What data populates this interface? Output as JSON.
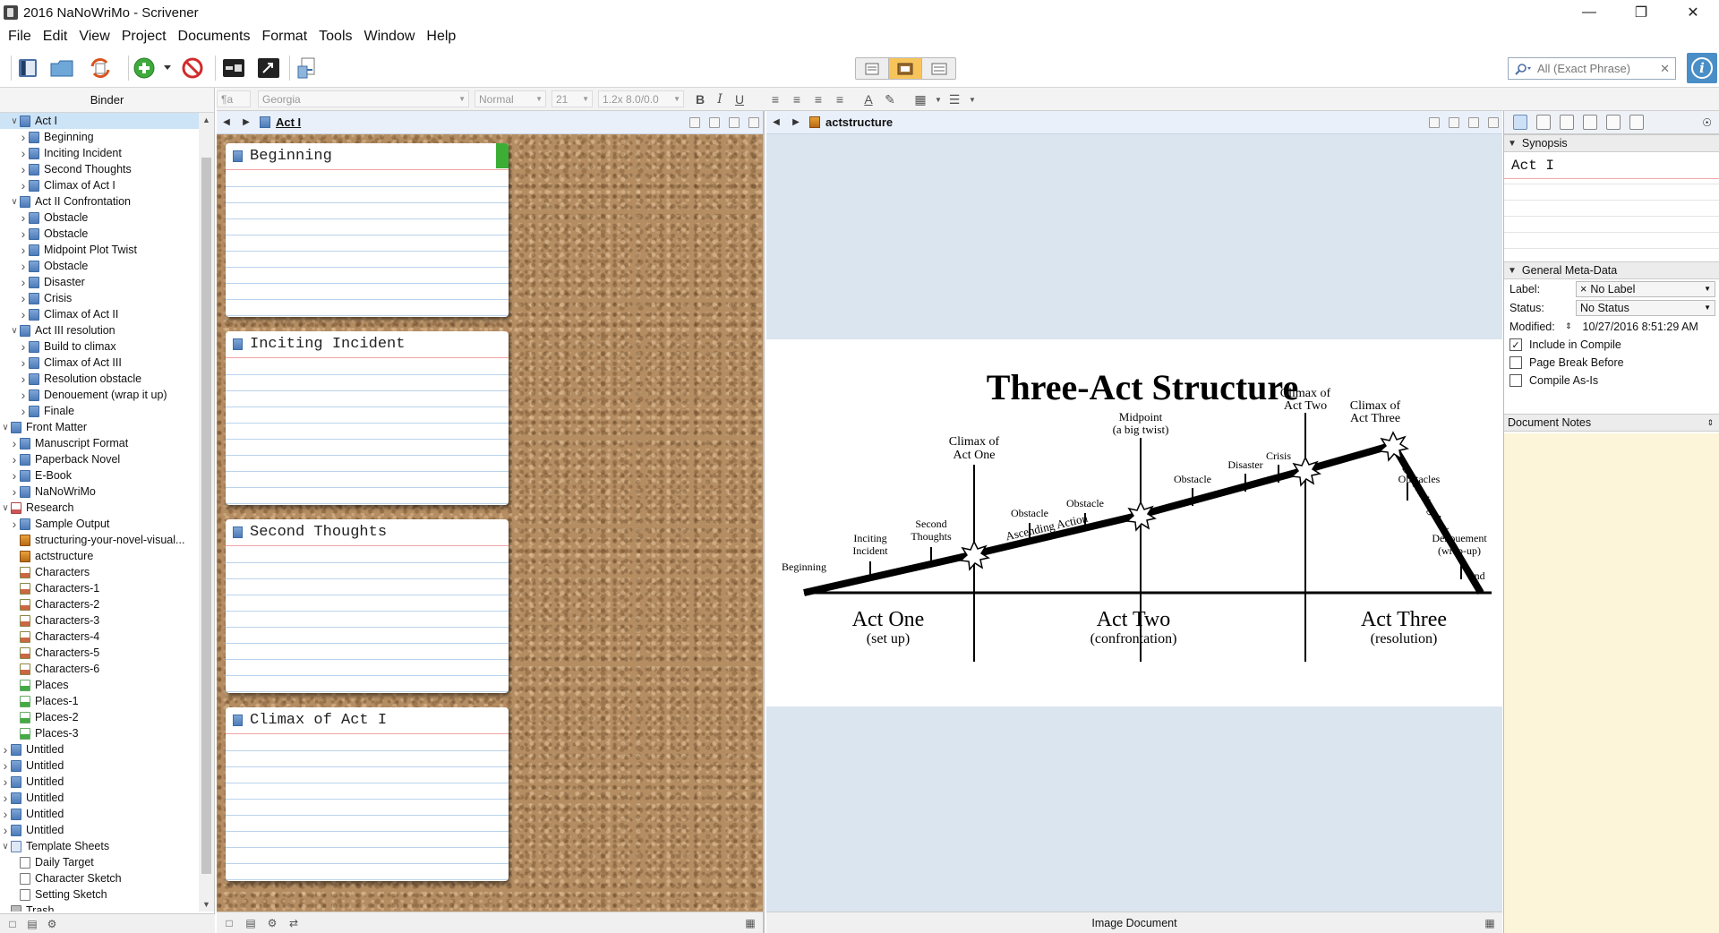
{
  "window": {
    "title": "2016 NaNoWriMo - Scrivener"
  },
  "menu": [
    "File",
    "Edit",
    "View",
    "Project",
    "Documents",
    "Format",
    "Tools",
    "Window",
    "Help"
  ],
  "toolbar": {
    "icons": [
      "binder-toggle-icon",
      "collections-icon",
      "sync-icon",
      "add-icon",
      "delete-icon",
      "quick-reference-icon",
      "fullscreen-icon",
      "compile-icon"
    ],
    "search_placeholder": "All (Exact Phrase)",
    "accent_color": "#f7c45b"
  },
  "binder": {
    "header": "Binder",
    "items": [
      {
        "label": "Act I",
        "depth": 0,
        "chev": "v",
        "icon": "folder",
        "selected": true
      },
      {
        "label": "Beginning",
        "depth": 1,
        "chev": ">",
        "icon": "folder"
      },
      {
        "label": "Inciting Incident",
        "depth": 1,
        "chev": ">",
        "icon": "folder"
      },
      {
        "label": "Second Thoughts",
        "depth": 1,
        "chev": ">",
        "icon": "folder"
      },
      {
        "label": "Climax of Act I",
        "depth": 1,
        "chev": ">",
        "icon": "folder"
      },
      {
        "label": "Act II Confrontation",
        "depth": 0,
        "chev": "v",
        "icon": "folder"
      },
      {
        "label": "Obstacle",
        "depth": 1,
        "chev": ">",
        "icon": "folder"
      },
      {
        "label": "Obstacle",
        "depth": 1,
        "chev": ">",
        "icon": "folder"
      },
      {
        "label": "Midpoint Plot Twist",
        "depth": 1,
        "chev": ">",
        "icon": "folder"
      },
      {
        "label": "Obstacle",
        "depth": 1,
        "chev": ">",
        "icon": "folder"
      },
      {
        "label": "Disaster",
        "depth": 1,
        "chev": ">",
        "icon": "folder"
      },
      {
        "label": "Crisis",
        "depth": 1,
        "chev": ">",
        "icon": "folder"
      },
      {
        "label": "Climax of Act II",
        "depth": 1,
        "chev": ">",
        "icon": "folder"
      },
      {
        "label": "Act III resolution",
        "depth": 0,
        "chev": "v",
        "icon": "folder"
      },
      {
        "label": "Build to climax",
        "depth": 1,
        "chev": ">",
        "icon": "folder"
      },
      {
        "label": "Climax of Act III",
        "depth": 1,
        "chev": ">",
        "icon": "folder"
      },
      {
        "label": "Resolution obstacle",
        "depth": 1,
        "chev": ">",
        "icon": "folder"
      },
      {
        "label": "Denouement (wrap it up)",
        "depth": 1,
        "chev": ">",
        "icon": "folder"
      },
      {
        "label": "Finale",
        "depth": 1,
        "chev": ">",
        "icon": "folder"
      },
      {
        "label": "Front Matter",
        "depth": -1,
        "chev": "v",
        "icon": "folder"
      },
      {
        "label": "Manuscript Format",
        "depth": 0,
        "chev": ">",
        "icon": "folder"
      },
      {
        "label": "Paperback Novel",
        "depth": 0,
        "chev": ">",
        "icon": "folder"
      },
      {
        "label": "E-Book",
        "depth": 0,
        "chev": ">",
        "icon": "folder"
      },
      {
        "label": "NaNoWriMo",
        "depth": 0,
        "chev": ">",
        "icon": "folder"
      },
      {
        "label": "Research",
        "depth": -1,
        "chev": "v",
        "icon": "research"
      },
      {
        "label": "Sample Output",
        "depth": 0,
        "chev": ">",
        "icon": "folder"
      },
      {
        "label": "structuring-your-novel-visual...",
        "depth": 0,
        "chev": "",
        "icon": "img"
      },
      {
        "label": "actstructure",
        "depth": 0,
        "chev": "",
        "icon": "img"
      },
      {
        "label": "Characters",
        "depth": 0,
        "chev": "",
        "icon": "pic"
      },
      {
        "label": "Characters-1",
        "depth": 0,
        "chev": "",
        "icon": "pic"
      },
      {
        "label": "Characters-2",
        "depth": 0,
        "chev": "",
        "icon": "pic"
      },
      {
        "label": "Characters-3",
        "depth": 0,
        "chev": "",
        "icon": "pic"
      },
      {
        "label": "Characters-4",
        "depth": 0,
        "chev": "",
        "icon": "pic"
      },
      {
        "label": "Characters-5",
        "depth": 0,
        "chev": "",
        "icon": "pic"
      },
      {
        "label": "Characters-6",
        "depth": 0,
        "chev": "",
        "icon": "pic"
      },
      {
        "label": "Places",
        "depth": 0,
        "chev": "",
        "icon": "place"
      },
      {
        "label": "Places-1",
        "depth": 0,
        "chev": "",
        "icon": "place"
      },
      {
        "label": "Places-2",
        "depth": 0,
        "chev": "",
        "icon": "place"
      },
      {
        "label": "Places-3",
        "depth": 0,
        "chev": "",
        "icon": "place"
      },
      {
        "label": "Untitled",
        "depth": -1,
        "chev": ">",
        "icon": "folder"
      },
      {
        "label": "Untitled",
        "depth": -1,
        "chev": ">",
        "icon": "folder"
      },
      {
        "label": "Untitled",
        "depth": -1,
        "chev": ">",
        "icon": "folder"
      },
      {
        "label": "Untitled",
        "depth": -1,
        "chev": ">",
        "icon": "folder"
      },
      {
        "label": "Untitled",
        "depth": -1,
        "chev": ">",
        "icon": "folder"
      },
      {
        "label": "Untitled",
        "depth": -1,
        "chev": ">",
        "icon": "folder"
      },
      {
        "label": "Template Sheets",
        "depth": -1,
        "chev": "v",
        "icon": "tmpl"
      },
      {
        "label": "Daily Target",
        "depth": 0,
        "chev": "",
        "icon": "doc"
      },
      {
        "label": "Character Sketch",
        "depth": 0,
        "chev": "",
        "icon": "doc"
      },
      {
        "label": "Setting Sketch",
        "depth": 0,
        "chev": "",
        "icon": "doc"
      },
      {
        "label": "Trash",
        "depth": -1,
        "chev": "",
        "icon": "trash"
      }
    ]
  },
  "formatbar": {
    "style": "¶a",
    "font": "Georgia",
    "weight": "Normal",
    "size": "21",
    "spacing": "1.2x 8.0/0.0"
  },
  "left_editor": {
    "title": "Act I",
    "cards": [
      {
        "title": "Beginning",
        "label_color": "#3cae35"
      },
      {
        "title": "Inciting Incident"
      },
      {
        "title": "Second Thoughts"
      },
      {
        "title": "Climax of Act I"
      }
    ]
  },
  "right_editor": {
    "title": "actstructure",
    "footer": "Image Document",
    "diagram": {
      "title": "Three-Act Structure",
      "acts": [
        {
          "name": "Act One",
          "sub": "(set up)"
        },
        {
          "name": "Act Two",
          "sub": "(confrontation)"
        },
        {
          "name": "Act Three",
          "sub": "(resolution)"
        }
      ],
      "labels": {
        "beginning": "Beginning",
        "inciting1": "Inciting",
        "inciting2": "Incident",
        "second1": "Second",
        "second2": "Thoughts",
        "climax1_1": "Climax of",
        "climax1_2": "Act One",
        "obstacle": "Obstacle",
        "midpoint1": "Midpoint",
        "midpoint2": "(a big twist)",
        "disaster": "Disaster",
        "crisis": "Crisis",
        "climax2_1": "Climax of",
        "climax2_2": "Act Two",
        "climax3_1": "Climax of",
        "climax3_2": "Act Three",
        "obstacles": "Obstacles",
        "denouement1": "Denouement",
        "denouement2": "(wrap-up)",
        "end": "End",
        "ascending": "Ascending Action",
        "descending": "Descending Action"
      }
    }
  },
  "inspector": {
    "synopsis_header": "Synopsis",
    "synopsis_text": "Act I",
    "meta_header": "General Meta-Data",
    "label_caption": "Label:",
    "label_value": "No Label",
    "status_caption": "Status:",
    "status_value": "No Status",
    "modified_caption": "Modified:",
    "modified_value": "10/27/2016 8:51:29 AM",
    "include_compile": "Include in Compile",
    "page_break": "Page Break Before",
    "compile_as_is": "Compile As-Is",
    "notes_header": "Document Notes",
    "notes_bg": "#fdf5da"
  }
}
